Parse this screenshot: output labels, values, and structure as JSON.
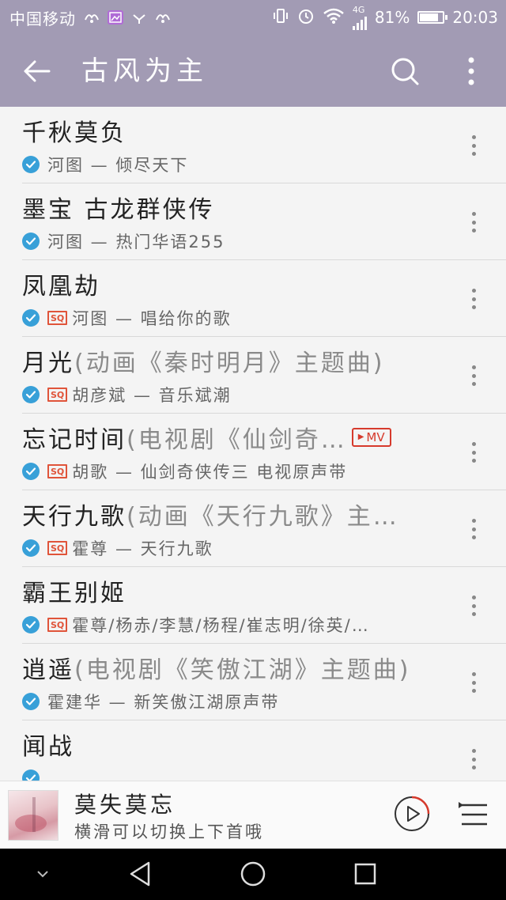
{
  "status_bar": {
    "carrier": "中国移动",
    "network": "4G",
    "battery": "81%",
    "battery_level": 0.81,
    "time": "20:03"
  },
  "header": {
    "title": "古风为主"
  },
  "songs": [
    {
      "title": "千秋莫负",
      "subtitle": "",
      "meta": "河图 — 倾尽天下",
      "sq": false,
      "mv": false
    },
    {
      "title": "墨宝 古龙群侠传",
      "subtitle": "",
      "meta": "河图 — 热门华语255",
      "sq": false,
      "mv": false
    },
    {
      "title": "凤凰劫",
      "subtitle": "",
      "meta": "河图 — 唱给你的歌",
      "sq": true,
      "mv": false
    },
    {
      "title": "月光",
      "subtitle": "(动画《秦时明月》主题曲)",
      "meta": "胡彦斌 — 音乐斌潮",
      "sq": true,
      "mv": false
    },
    {
      "title": "忘记时间",
      "subtitle": "(电视剧《仙剑奇…",
      "meta": "胡歌 — 仙剑奇侠传三 电视原声带",
      "sq": true,
      "mv": true
    },
    {
      "title": "天行九歌",
      "subtitle": "(动画《天行九歌》主…",
      "meta": "霍尊 — 天行九歌",
      "sq": true,
      "mv": false
    },
    {
      "title": "霸王别姬",
      "subtitle": "",
      "meta": "霍尊/杨赤/李慧/杨程/崔志明/徐英/…",
      "sq": true,
      "mv": false
    },
    {
      "title": "逍遥",
      "subtitle": "(电视剧《笑傲江湖》主题曲)",
      "meta": "霍建华 — 新笑傲江湖原声带",
      "sq": false,
      "mv": false
    },
    {
      "title": "闻战",
      "subtitle": "",
      "meta": "",
      "sq": false,
      "mv": false
    }
  ],
  "badges": {
    "sq_label": "SQ",
    "mv_label": "MV"
  },
  "now_playing": {
    "title": "莫失莫忘",
    "hint": "横滑可以切换上下首哦"
  },
  "colors": {
    "header": "#a29bb4",
    "download_check": "#38a0d8",
    "badge_red": "#d63a2c"
  }
}
